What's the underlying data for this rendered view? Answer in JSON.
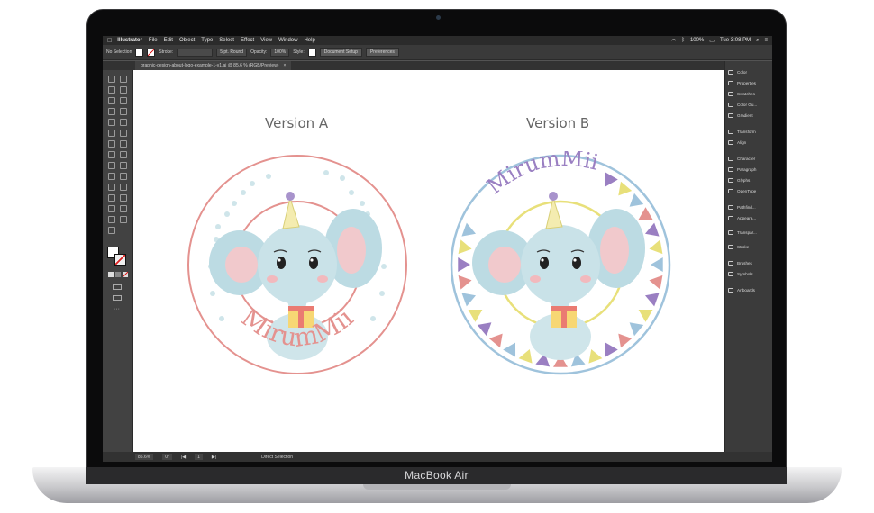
{
  "laptop": {
    "brand": "MacBook Air"
  },
  "menubar": {
    "apple_icon": "apple-icon",
    "items": [
      "Illustrator",
      "File",
      "Edit",
      "Object",
      "Type",
      "Select",
      "Effect",
      "View",
      "Window",
      "Help"
    ],
    "battery": "100%",
    "clock": "Tue 3:08 PM"
  },
  "controlbar": {
    "selection": "No Selection",
    "stroke_label": "Stroke:",
    "brush": "5 pt. Round",
    "opacity_label": "Opacity:",
    "opacity_value": "100%",
    "style_label": "Style:",
    "doc_setup": "Document Setup",
    "preferences": "Preferences"
  },
  "document": {
    "tab_title": "graphic-design-about-logo-example-1-v1.ai @ 85.6 % (RGB/Preview)",
    "close": "×"
  },
  "artboard": {
    "version_a": "Version A",
    "version_b": "Version B",
    "logo_text": "MirumMii"
  },
  "panels": [
    "Color",
    "Properties",
    "Swatches",
    "Color Gu...",
    "Gradient",
    "Transform",
    "Align",
    "Character",
    "Paragraph",
    "Glyphs",
    "OpenType",
    "Pathfind...",
    "Appeara...",
    "Transpar...",
    "Stroke",
    "Brushes",
    "Symbols",
    "Artboards"
  ],
  "status": {
    "zoom": "85.6%",
    "rotation": "0°",
    "page": "1",
    "tool": "Direct Selection"
  },
  "colors": {
    "pink": "#e4928f",
    "blue": "#9fc3dc",
    "purple": "#9a7fc2",
    "yellow": "#e8e07a",
    "elephant": "#bcdbe3"
  }
}
